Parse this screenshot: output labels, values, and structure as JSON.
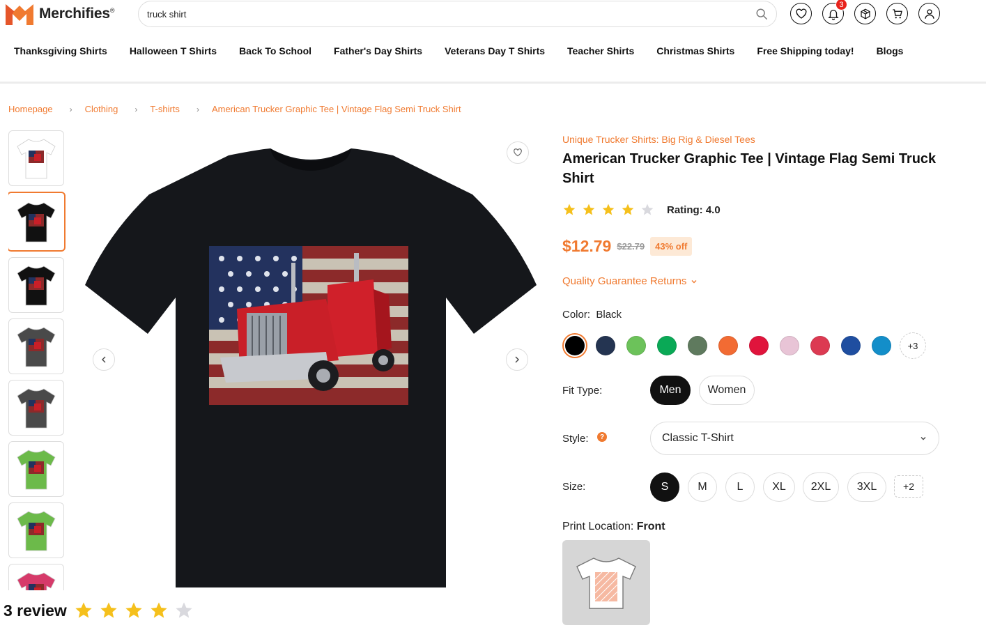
{
  "brand": {
    "name": "Merchifies",
    "mark": "®",
    "color": "#f07a30"
  },
  "search": {
    "value": "truck shirt"
  },
  "header_icons": [
    {
      "name": "wishlist-icon"
    },
    {
      "name": "notification-icon",
      "badge": "3"
    },
    {
      "name": "orders-icon"
    },
    {
      "name": "cart-icon"
    },
    {
      "name": "account-icon"
    }
  ],
  "nav": [
    "Thanksgiving Shirts",
    "Halloween T Shirts",
    "Back To School",
    "Father's Day Shirts",
    "Veterans Day T Shirts",
    "Teacher Shirts",
    "Christmas Shirts",
    "Free Shipping today!",
    "Blogs"
  ],
  "breadcrumb": [
    "Homepage",
    "Clothing",
    "T-shirts",
    "American Trucker Graphic Tee | Vintage Flag Semi Truck Shirt"
  ],
  "thumbnails": [
    {
      "color": "#ffffff"
    },
    {
      "color": "#111111"
    },
    {
      "color": "#111111"
    },
    {
      "color": "#4a4a4a"
    },
    {
      "color": "#4a4a4a"
    },
    {
      "color": "#6cba4a"
    },
    {
      "color": "#6cba4a"
    },
    {
      "color": "#d63a6a"
    }
  ],
  "review": {
    "text": "3 review",
    "stars": 4,
    "max": 5
  },
  "product": {
    "store": "Unique Trucker Shirts: Big Rig & Diesel Tees",
    "title": "American Trucker Graphic Tee | Vintage Flag Semi Truck Shirt",
    "rating": 4,
    "rating_max": 5,
    "rating_label": "Rating: 4.0",
    "price": "$12.79",
    "old_price": "$22.79",
    "discount": "43% off",
    "guarantee": "Quality Guarantee Returns",
    "color_label": "Color:",
    "color_value": "Black",
    "colors": [
      "#000000",
      "#243451",
      "#6cc25a",
      "#0aa956",
      "#5f7a5e",
      "#f26b33",
      "#e0143c",
      "#e8c4d6",
      "#dc3a52",
      "#1f4ea0",
      "#138ec9"
    ],
    "colors_more": "+3",
    "fit_label": "Fit Type:",
    "fit_options": [
      "Men",
      "Women"
    ],
    "style_label": "Style:",
    "style_help": "?",
    "style_value": "Classic T-Shirt",
    "size_label": "Size:",
    "sizes": [
      "S",
      "M",
      "L",
      "XL",
      "2XL",
      "3XL"
    ],
    "sizes_more": "+2",
    "print_label": "Print Location:",
    "print_value": "Front"
  }
}
